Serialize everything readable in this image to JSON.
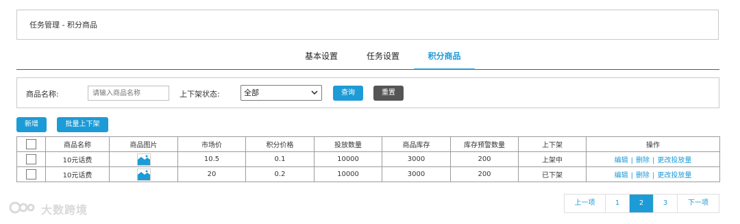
{
  "breadcrumb": "任务管理 - 积分商品",
  "tabs": [
    {
      "label": "基本设置",
      "active": false
    },
    {
      "label": "任务设置",
      "active": false
    },
    {
      "label": "积分商品",
      "active": true
    }
  ],
  "search": {
    "name_label": "商品名称:",
    "name_placeholder": "请输入商品名称",
    "status_label": "上下架状态:",
    "status_value": "全部",
    "query_label": "查询",
    "reset_label": "重置"
  },
  "actions": {
    "add_label": "新增",
    "batch_label": "批量上下架"
  },
  "table": {
    "headers": [
      "商品名称",
      "商品图片",
      "市场价",
      "积分价格",
      "投放数量",
      "商品库存",
      "库存预警数量",
      "上下架",
      "操作"
    ],
    "rows": [
      {
        "name": "10元话费",
        "market_price": "10.5",
        "points_price": "0.1",
        "quantity": "10000",
        "stock": "3000",
        "warn": "200",
        "status": "上架中"
      },
      {
        "name": "10元话费",
        "market_price": "20",
        "points_price": "0.2",
        "quantity": "10000",
        "stock": "3000",
        "warn": "200",
        "status": "已下架"
      }
    ],
    "op_edit": "编辑",
    "op_delete": "删除",
    "op_change": "更改投放量",
    "op_sep": "|"
  },
  "pagination": {
    "prev": "上一项",
    "pages": [
      "1",
      "2",
      "3"
    ],
    "current": "2",
    "next": "下一项"
  },
  "watermark": "大数跨境",
  "colors": {
    "accent": "#1d9bd6",
    "dark_button": "#555555"
  }
}
